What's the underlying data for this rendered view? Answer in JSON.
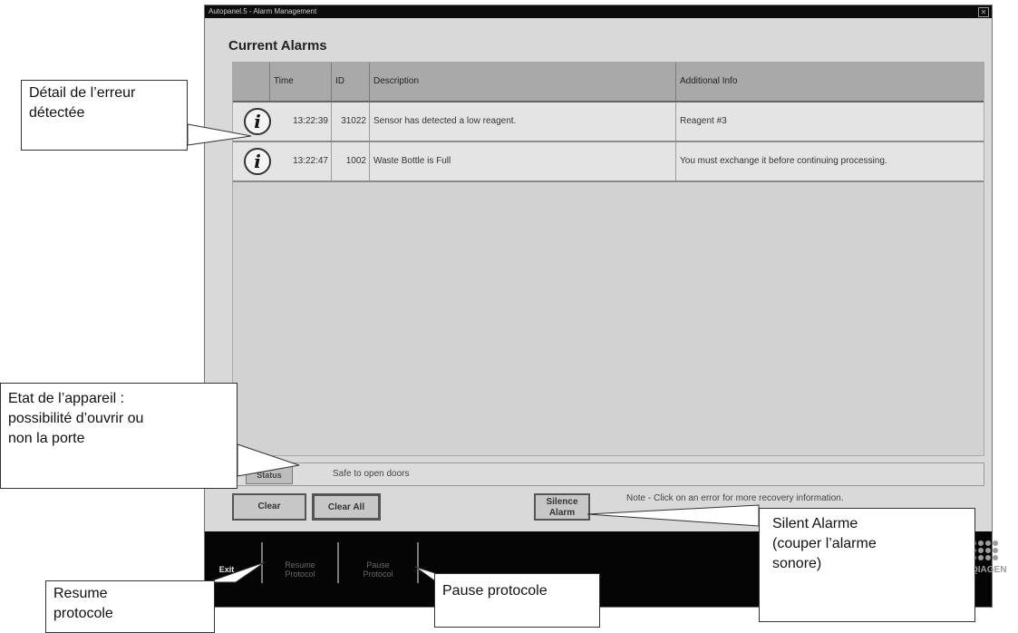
{
  "window": {
    "title": "Autopanel.5 - Alarm Management",
    "close_glyph": "✕"
  },
  "heading": "Current Alarms",
  "table": {
    "columns": [
      "",
      "Time",
      "ID",
      "Description",
      "Additional Info"
    ],
    "rows": [
      {
        "icon": "info-icon",
        "time": "13:22:39",
        "id": "31022",
        "description": "Sensor has detected a low reagent.",
        "info": "Reagent #3"
      },
      {
        "icon": "info-icon",
        "time": "13:22:47",
        "id": "1002",
        "description": "Waste Bottle is Full",
        "info": "You must exchange it before continuing processing."
      }
    ]
  },
  "status": {
    "label": "Status",
    "text": "Safe to open doors"
  },
  "buttons": {
    "clear": "Clear",
    "clear_all": "Clear All",
    "silence_line1": "Silence",
    "silence_line2": "Alarm",
    "note": "Note - Click on an error for more recovery information."
  },
  "bottombar": {
    "exit": "Exit",
    "resume_line1": "Resume",
    "resume_line2": "Protocol",
    "pause_line1": "Pause",
    "pause_line2": "Protocol",
    "logo_text": "QIAGEN"
  },
  "callouts": {
    "detail_line1": "Détail de l’erreur",
    "detail_line2": "détectée",
    "etat_line1": "Etat de l’appareil :",
    "etat_line2": "possibilité d’ouvrir ou",
    "etat_line3": "non la porte",
    "silent_line1": "Silent Alarme",
    "silent_line2": "(couper l’alarme",
    "silent_line3": "sonore)",
    "resume_line1": "Resume",
    "resume_line2": "protocole",
    "pause": "Pause protocole"
  }
}
